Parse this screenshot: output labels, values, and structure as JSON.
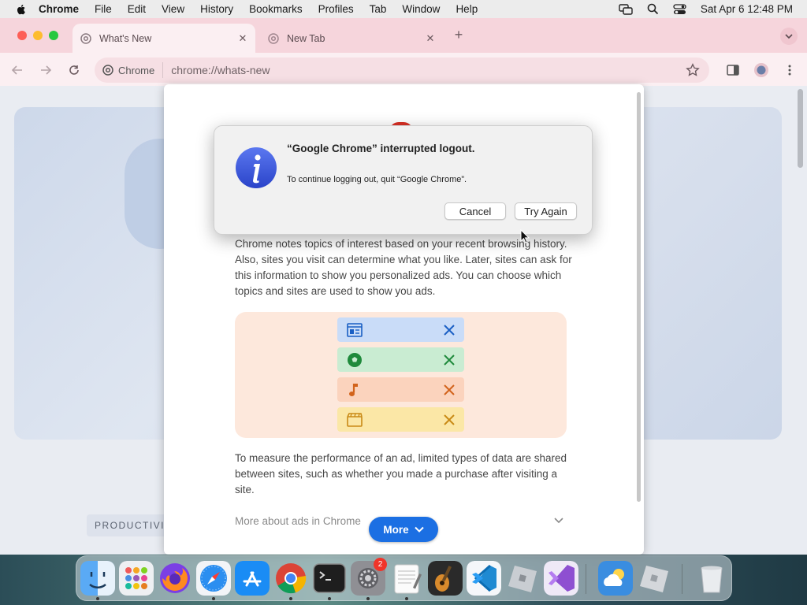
{
  "menubar": {
    "app_name": "Chrome",
    "items": [
      "File",
      "Edit",
      "View",
      "History",
      "Bookmarks",
      "Profiles",
      "Tab",
      "Window",
      "Help"
    ],
    "clock": "Sat Apr 6  12:48 PM"
  },
  "tabs": [
    {
      "title": "What's New",
      "active": true
    },
    {
      "title": "New Tab",
      "active": false
    }
  ],
  "omnibox": {
    "chip_label": "Chrome",
    "url": "chrome://whats-new"
  },
  "page": {
    "section_tag": "PRODUCTIVITY",
    "paragraph_1": "Chrome notes topics of interest based on your recent browsing history. Also, sites you visit can determine what you like. Later, sites can ask for this information to show you personalized ads. You can choose which topics and sites are used to show you ads.",
    "paragraph_2": "To measure the performance of an ad, limited types of data are shared between sites, such as whether you made a purchase after visiting a site.",
    "more_about_ads": "More about ads in Chrome",
    "more_button": "More",
    "topics": [
      {
        "icon": "newspaper-icon",
        "bg": "#c9dcf8",
        "fg": "#1a5fc4"
      },
      {
        "icon": "soccer-ball-icon",
        "bg": "#c9ecd2",
        "fg": "#1f8a3c"
      },
      {
        "icon": "music-note-icon",
        "bg": "#fbd3bd",
        "fg": "#d2631b"
      },
      {
        "icon": "clapperboard-icon",
        "bg": "#fbe7a6",
        "fg": "#c98a16"
      }
    ]
  },
  "alert": {
    "title": "“Google Chrome” interrupted logout.",
    "message": "To continue logging out, quit “Google Chrome”.",
    "cancel_label": "Cancel",
    "try_again_label": "Try Again"
  },
  "dock": {
    "apps": [
      "Finder",
      "Launchpad",
      "Firefox",
      "Safari",
      "App Store",
      "Google Chrome",
      "Terminal",
      "System Settings",
      "TextEdit",
      "GarageBand",
      "Visual Studio Code",
      "Roblox",
      "Visual Studio",
      "Weather",
      "Roblox Studio",
      "Trash"
    ],
    "settings_badge": "2"
  }
}
